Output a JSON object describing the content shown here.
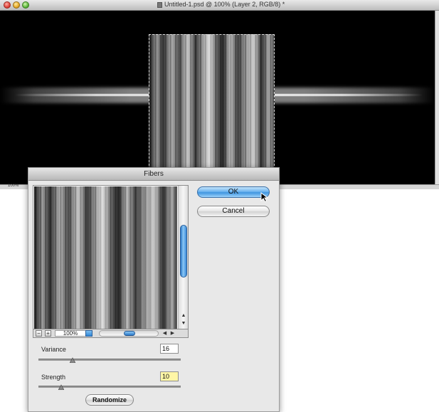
{
  "window": {
    "title": "Untitled-1.psd @ 100% (Layer 2, RGB/8) *",
    "status_zoom": "100%"
  },
  "dialog": {
    "title": "Fibers",
    "ok_label": "OK",
    "cancel_label": "Cancel",
    "preview_zoom": "100%",
    "zoom_out_symbol": "−",
    "zoom_in_symbol": "+",
    "variance_label": "Variance",
    "variance_value": "16",
    "strength_label": "Strength",
    "strength_value": "10",
    "randomize_label": "Randomize",
    "variance_slider_fraction": 0.24,
    "strength_slider_fraction": 0.16
  },
  "colors": {
    "accent": "#3f95e0",
    "field_highlight": "#fff6a6",
    "canvas": "#000000"
  },
  "icons": [
    "close-icon",
    "minimize-icon",
    "zoom-icon",
    "document-icon",
    "mouse-cursor-icon",
    "scroll-up-icon",
    "scroll-down-icon",
    "scroll-left-icon",
    "scroll-right-icon",
    "slider-knob-icon"
  ]
}
